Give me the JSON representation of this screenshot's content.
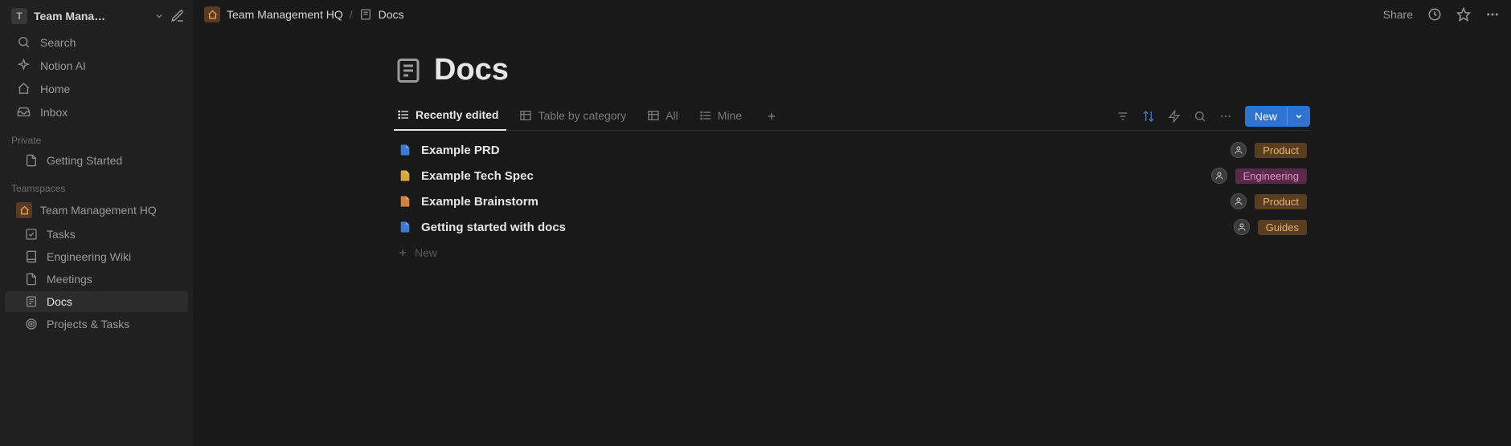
{
  "workspace": {
    "initial": "T",
    "name": "Team Mana…"
  },
  "sidebar": {
    "nav": [
      {
        "key": "search",
        "label": "Search"
      },
      {
        "key": "ai",
        "label": "Notion AI"
      },
      {
        "key": "home",
        "label": "Home"
      },
      {
        "key": "inbox",
        "label": "Inbox"
      }
    ],
    "private_label": "Private",
    "private_items": [
      {
        "key": "getting-started",
        "label": "Getting Started"
      }
    ],
    "teamspaces_label": "Teamspaces",
    "teamspace_name": "Team Management HQ",
    "teamspace_items": [
      {
        "key": "tasks",
        "label": "Tasks"
      },
      {
        "key": "wiki",
        "label": "Engineering Wiki"
      },
      {
        "key": "meetings",
        "label": "Meetings"
      },
      {
        "key": "docs",
        "label": "Docs",
        "active": true
      },
      {
        "key": "projects",
        "label": "Projects & Tasks"
      }
    ]
  },
  "breadcrumb": {
    "root": "Team Management HQ",
    "current": "Docs"
  },
  "topbar": {
    "share": "Share"
  },
  "page": {
    "title": "Docs"
  },
  "views": [
    {
      "key": "recent",
      "label": "Recently edited",
      "type": "list",
      "active": true
    },
    {
      "key": "bycat",
      "label": "Table by category",
      "type": "table"
    },
    {
      "key": "all",
      "label": "All",
      "type": "table"
    },
    {
      "key": "mine",
      "label": "Mine",
      "type": "list"
    }
  ],
  "new_button": "New",
  "docs": [
    {
      "title": "Example PRD",
      "icon_color": "#3a7bd5",
      "tag": "Product",
      "tag_class": "product"
    },
    {
      "title": "Example Tech Spec",
      "icon_color": "#d5a93a",
      "tag": "Engineering",
      "tag_class": "engineering"
    },
    {
      "title": "Example Brainstorm",
      "icon_color": "#d5803a",
      "tag": "Product",
      "tag_class": "product"
    },
    {
      "title": "Getting started with docs",
      "icon_color": "#3a7bd5",
      "tag": "Guides",
      "tag_class": "guides"
    }
  ],
  "new_row": "New"
}
